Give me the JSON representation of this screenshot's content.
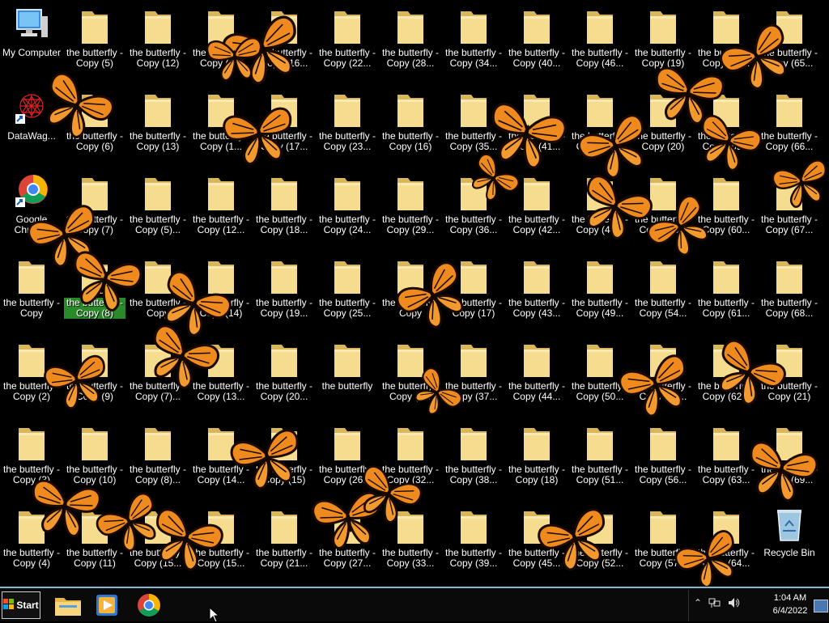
{
  "desktop": {
    "system_icons": [
      {
        "id": "my-computer",
        "label": "My Computer",
        "icon": "computer-icon"
      },
      {
        "id": "datawag",
        "label": "DataWag...",
        "icon": "datawag-icon"
      },
      {
        "id": "google-chrome",
        "label": "Google Chrome",
        "icon": "chrome-icon"
      },
      {
        "id": "recycle-bin",
        "label": "Recycle Bin",
        "icon": "recycle-bin-icon"
      }
    ],
    "folder_columns": [
      [
        "the butterfly - Copy (5)",
        "the butterfly - Copy (6)",
        "the butterfly - Copy (7)",
        "the butterfly - Copy (8)",
        "the butterfly - Copy (9)",
        "the butterfly - Copy (10)",
        "the butterfly - Copy (11)"
      ],
      [
        "the butterfly - Copy (12)",
        "the butterfly - Copy (13)",
        "the butterfly - Copy (5)...",
        "the butterfly - Copy",
        "the butterfly - Copy (7)...",
        "the butterfly - Copy (8)...",
        "the butterfly - Copy (15..."
      ],
      [
        "the butterfly - Copy (1...",
        "the butterfly - Copy (1...",
        "the butterfly - Copy (12...",
        "the butterfly - Copy (14)",
        "the butterfly - Copy (13...",
        "the butterfly - Copy (14...",
        "the butterfly - Copy (15..."
      ],
      [
        "the butterfly - Copy (16...",
        "the butterfly - Copy (17...",
        "the butterfly - Copy (18...",
        "the butterfly - Copy (19...",
        "the butterfly - Copy (20...",
        "the butterfly - Copy (15)",
        "the butterfly - Copy (21..."
      ],
      [
        "the butterfly - Copy (22...",
        "the butterfly - Copy (23...",
        "the butterfly - Copy (24...",
        "the butterfly - Copy (25...",
        "the butterfly",
        "the butterfly - Copy (26...",
        "the butterfly - Copy (27..."
      ],
      [
        "the butterfly - Copy (28...",
        "the butterfly - Copy (16)",
        "the butterfly - Copy (29...",
        "the butterfly - Copy",
        "the butterfly - Copy (3...",
        "the butterfly - Copy (32...",
        "the butterfly - Copy (33..."
      ],
      [
        "the butterfly - Copy (34...",
        "the butterfly - Copy (35...",
        "the butterfly - Copy (36...",
        "the butterfly - Copy (17)",
        "the butterfly - Copy (37...",
        "the butterfly - Copy (38...",
        "the butterfly - Copy (39..."
      ],
      [
        "the butterfly - Copy (40...",
        "the butterfly - Copy (41...",
        "the butterfly - Copy (42...",
        "the butterfly - Copy (43...",
        "the butterfly - Copy (44...",
        "the butterfly - Copy (18)",
        "the butterfly - Copy (45..."
      ],
      [
        "the butterfly - Copy (46...",
        "the butterfly - Copy (47...",
        "the butterfly - Copy (48...",
        "the butterfly - Copy (49...",
        "the butterfly - Copy (50...",
        "the butterfly - Copy (51...",
        "the butterfly - Copy (52..."
      ],
      [
        "the butterfly - Copy (19)",
        "the butterfly - Copy (20)",
        "the butterfly - Copy (53...",
        "the butterfly - Copy (54...",
        "the butterfly - Copy (55...",
        "the butterfly - Copy (56...",
        "the butterfly - Copy (57..."
      ],
      [
        "the butterfly - Copy (58...",
        "the butterfly - Copy (59...",
        "the butterfly - Copy (60...",
        "the butterfly - Copy (61...",
        "the butterfly - Copy (62...",
        "the butterfly - Copy (63...",
        "the butterfly - Copy (64..."
      ],
      [
        "the butterfly - Copy (65...",
        "the butterfly - Copy (66...",
        "the butterfly - Copy (67...",
        "the butterfly - Copy (68...",
        "the butterfly - Copy (21)",
        "the butterfly - Copy (69...",
        ""
      ]
    ],
    "first_column_folders": [
      "the butterfly - Copy",
      "the butterfly - Copy (2)",
      "the butterfly - Copy (3)",
      "the butterfly - Copy (4)"
    ],
    "selected_label": "the butterfly - Copy (8)",
    "colors": {
      "background": "#000000",
      "selection": "#2a8a2a",
      "folder": "#f3d27a",
      "butterfly": "#f08a1c"
    }
  },
  "taskbar": {
    "start_label": "Start",
    "pinned": [
      {
        "id": "file-explorer",
        "icon": "folder-icon"
      },
      {
        "id": "media-player",
        "icon": "media-player-icon"
      },
      {
        "id": "chrome",
        "icon": "chrome-icon"
      }
    ],
    "tray": {
      "time": "1:04 AM",
      "date": "6/4/2022",
      "icons": [
        "chevron-up-icon",
        "network-icon",
        "volume-icon"
      ]
    }
  }
}
